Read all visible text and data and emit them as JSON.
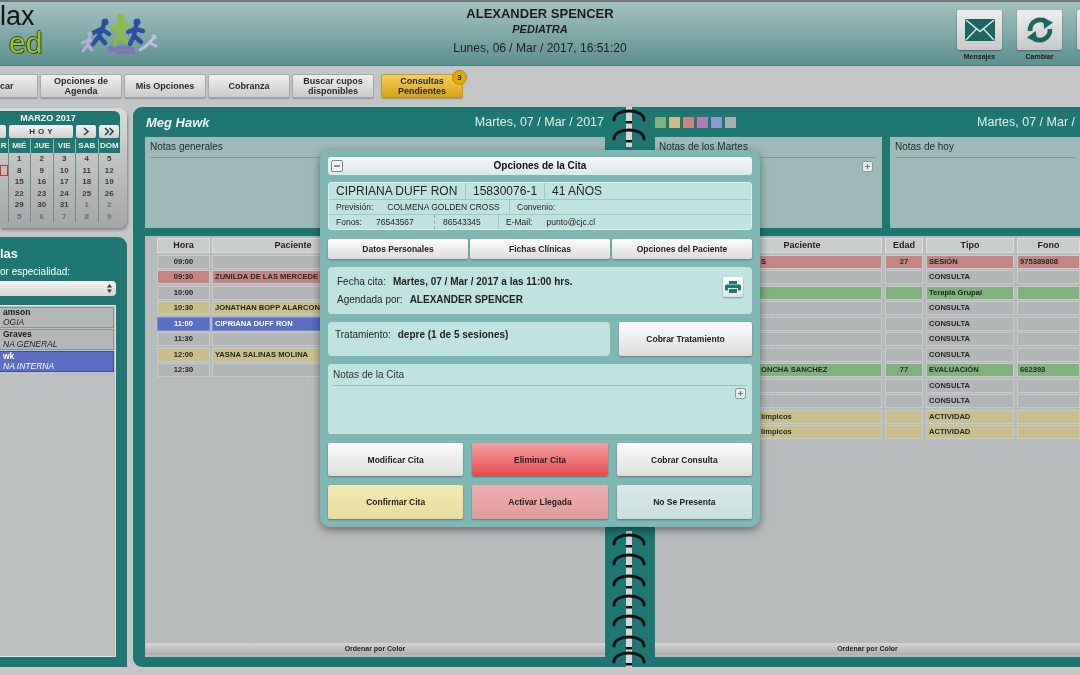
{
  "header": {
    "logo": [
      "lax",
      "ed"
    ],
    "user": "ALEXANDER SPENCER",
    "role": "PEDIATRA",
    "datetime": "Lunes, 06 / Mar / 2017, 16:51:20",
    "tools": [
      {
        "kind": "mail",
        "label": "Mensajes"
      },
      {
        "kind": "refresh",
        "label": "Cambiar"
      },
      {
        "kind": "partial"
      }
    ]
  },
  "nav": [
    {
      "label": "car",
      "highlighted": false
    },
    {
      "label": "Opciones de Agenda",
      "highlighted": false
    },
    {
      "label": "Mis Opciones",
      "highlighted": false
    },
    {
      "label": "Cobranza",
      "highlighted": false
    },
    {
      "label": "Buscar cupos disponibles",
      "highlighted": false
    },
    {
      "label": "Consultas Pendientes",
      "highlighted": true,
      "badge": "3"
    }
  ],
  "calendar": {
    "title": "MARZO 2017",
    "today": "HOY",
    "weekdays": [
      "R",
      "MIÉ",
      "JUE",
      "VIE",
      "SAB",
      "DOM"
    ],
    "weeks": [
      {
        "days": [
          {
            "kind": "cut",
            "selected": false
          },
          {
            "kind": "day",
            "day": "1",
            "muted": false,
            "selected": false
          },
          {
            "kind": "day",
            "day": "2",
            "muted": false,
            "selected": false
          },
          {
            "kind": "day",
            "day": "3",
            "muted": false,
            "selected": false
          },
          {
            "kind": "day",
            "day": "4",
            "muted": false,
            "selected": false
          },
          {
            "kind": "day",
            "day": "5",
            "muted": false,
            "selected": false
          }
        ]
      },
      {
        "days": [
          {
            "kind": "cut",
            "selected": true
          },
          {
            "kind": "day",
            "day": "8",
            "muted": false,
            "selected": false
          },
          {
            "kind": "day",
            "day": "9",
            "muted": false,
            "selected": false
          },
          {
            "kind": "day",
            "day": "10",
            "muted": false,
            "selected": false
          },
          {
            "kind": "day",
            "day": "11",
            "muted": false,
            "selected": false
          },
          {
            "kind": "day",
            "day": "12",
            "muted": false,
            "selected": false
          }
        ]
      },
      {
        "days": [
          {
            "kind": "cut",
            "selected": false
          },
          {
            "kind": "day",
            "day": "15",
            "muted": false,
            "selected": false
          },
          {
            "kind": "day",
            "day": "16",
            "muted": false,
            "selected": false
          },
          {
            "kind": "day",
            "day": "17",
            "muted": false,
            "selected": false
          },
          {
            "kind": "day",
            "day": "18",
            "muted": false,
            "selected": false
          },
          {
            "kind": "day",
            "day": "19",
            "muted": false,
            "selected": false
          }
        ]
      },
      {
        "days": [
          {
            "kind": "cut",
            "selected": false
          },
          {
            "kind": "day",
            "day": "22",
            "muted": false,
            "selected": false
          },
          {
            "kind": "day",
            "day": "23",
            "muted": false,
            "selected": false
          },
          {
            "kind": "day",
            "day": "24",
            "muted": false,
            "selected": false
          },
          {
            "kind": "day",
            "day": "25",
            "muted": false,
            "selected": false
          },
          {
            "kind": "day",
            "day": "26",
            "muted": false,
            "selected": false
          }
        ]
      },
      {
        "days": [
          {
            "kind": "cut",
            "selected": false
          },
          {
            "kind": "day",
            "day": "29",
            "muted": false,
            "selected": false
          },
          {
            "kind": "day",
            "day": "30",
            "muted": false,
            "selected": false
          },
          {
            "kind": "day",
            "day": "31",
            "muted": false,
            "selected": false
          },
          {
            "kind": "day",
            "day": "1",
            "muted": true,
            "selected": false
          },
          {
            "kind": "day",
            "day": "2",
            "muted": true,
            "selected": false
          }
        ]
      },
      {
        "days": [
          {
            "kind": "cut",
            "selected": false
          },
          {
            "kind": "day",
            "day": "5",
            "muted": true,
            "selected": false
          },
          {
            "kind": "day",
            "day": "6",
            "muted": true,
            "selected": false
          },
          {
            "kind": "day",
            "day": "7",
            "muted": true,
            "selected": false
          },
          {
            "kind": "day",
            "day": "8",
            "muted": true,
            "selected": false
          },
          {
            "kind": "day",
            "day": "9",
            "muted": true,
            "selected": false
          }
        ]
      }
    ]
  },
  "sidebar": {
    "title": "las",
    "filter_label": "or especialidad:",
    "doctors": [
      {
        "name": "amson",
        "specialty": "OGIA",
        "selected": false
      },
      {
        "name": "Graves",
        "specialty": "NA GENERAL",
        "selected": false
      },
      {
        "name": "wk",
        "specialty": "NA INTERNA",
        "selected": true
      }
    ]
  },
  "left_page": {
    "doctor": "Meg Hawk",
    "date": "Martes, 07 / Mar / 2017",
    "notes": [
      {
        "title": "Notas generales",
        "add_icon": false
      }
    ],
    "table": {
      "columns": [
        "Hora",
        "Paciente"
      ],
      "rows": [
        {
          "time": "09:00",
          "selected": false
        },
        {
          "time": "09:30",
          "patient": "ZUNILDA DE LAS MERCEDE",
          "color": "#c68585",
          "selected": false
        },
        {
          "time": "10:00",
          "selected": false
        },
        {
          "time": "10:30",
          "patient": "JONATHAN BOPP ALARCON",
          "color": "#c9c08b",
          "selected": false
        },
        {
          "time": "11:00",
          "patient": "CIPRIANA DUFF RON",
          "selected": true
        },
        {
          "time": "11:30",
          "selected": false
        },
        {
          "time": "12:00",
          "patient": "YASNA SALINAS MOLINA",
          "color": "#c9c08b",
          "selected": false
        },
        {
          "time": "12:30",
          "selected": false
        }
      ]
    },
    "sort_button": "Ordenar por Color"
  },
  "right_page": {
    "swatches": [
      {
        "color": "#7fb27e"
      },
      {
        "color": "#c8bf88"
      },
      {
        "color": "#c78585"
      },
      {
        "color": "#b27ab6"
      },
      {
        "color": "#8a9bcd"
      },
      {
        "color": "#a5b2b0"
      }
    ],
    "date": "Martes, 07 / Mar /",
    "notes": [
      {
        "title": "Notas de los Martes",
        "add_icon": true
      },
      {
        "title": "Notas de hoy",
        "add_icon": false
      }
    ],
    "table": {
      "columns": [
        "Paciente",
        "Edad",
        "Tipo",
        "Fono"
      ],
      "rows": [
        {
          "patient": "S",
          "age": "27",
          "type": "SESIÓN",
          "phone": "975389808",
          "color": "#c68585",
          "selected": false
        },
        {
          "type": "CONSULTA",
          "selected": false
        },
        {
          "type": "Terapia Grupal",
          "color": "#80b27e",
          "selected": false
        },
        {
          "type": "CONSULTA",
          "selected": false
        },
        {
          "type": "CONSULTA",
          "selected": false
        },
        {
          "type": "CONSULTA",
          "selected": false
        },
        {
          "type": "CONSULTA",
          "selected": false
        },
        {
          "patient": "ONCHA SANCHEZ",
          "age": "77",
          "type": "EVALUACIÓN",
          "phone": "662393",
          "color": "#80b27e",
          "selected": false
        },
        {
          "type": "CONSULTA",
          "selected": false
        },
        {
          "type": "CONSULTA",
          "selected": false
        },
        {
          "patient": "límpicos",
          "type": "ACTIVIDAD",
          "color": "#c9c08b",
          "selected": false
        },
        {
          "patient": "límpicos",
          "type": "ACTIVIDAD",
          "color": "#c9c08b",
          "selected": false
        }
      ]
    },
    "sort_button": "Ordenar por Color"
  },
  "dialog": {
    "title": "Opciones de la Cita",
    "patient": {
      "name": "CIPRIANA DUFF RON",
      "id_number": "15830076-1",
      "age": "41 AÑOS",
      "insurance_label": "Previsión:",
      "insurance": "COLMENA GOLDEN CROSS",
      "agreement_label": "Convenio:",
      "phones_label": "Fonos:",
      "phones": [
        "76543567",
        "86543345"
      ],
      "email_label": "E-Mail:",
      "email": "punto@cjc.cl"
    },
    "patient_buttons": [
      "Datos Personales",
      "Fichas Clínicas",
      "Opciones del Paciente"
    ],
    "appointment": {
      "date_label": "Fecha cita:",
      "date": "Martes, 07 / Mar / 2017 a las 11:00 hrs.",
      "booked_by_label": "Agendada por:",
      "booked_by": "ALEXANDER SPENCER"
    },
    "treatment": {
      "label": "Tratamiento:",
      "value": "depre (1 de 5 sesiones)",
      "button": "Cobrar Tratamiento"
    },
    "notes_title": "Notas de la Cita",
    "actions": [
      {
        "label": "Modificar Cita",
        "kind": "plain"
      },
      {
        "label": "Eliminar Cita",
        "kind": "danger"
      },
      {
        "label": "Cobrar Consulta",
        "kind": "plain"
      },
      {
        "label": "Confirmar Cita",
        "kind": "confirm"
      },
      {
        "label": "Activar Llegada",
        "kind": "arrival"
      },
      {
        "label": "No Se Presenta",
        "kind": "absent"
      }
    ]
  }
}
